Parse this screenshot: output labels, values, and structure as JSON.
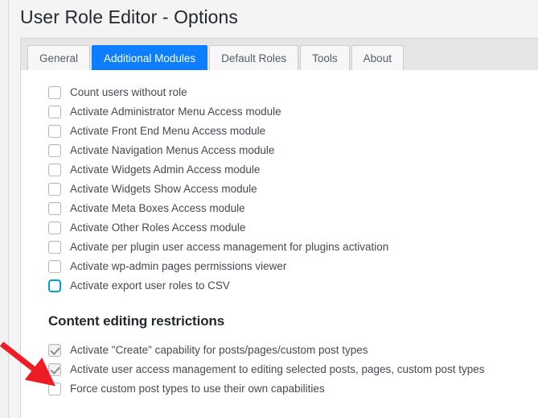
{
  "page": {
    "title": "User Role Editor - Options"
  },
  "tabs": [
    {
      "label": "General",
      "active": false
    },
    {
      "label": "Additional Modules",
      "active": true
    },
    {
      "label": "Default Roles",
      "active": false
    },
    {
      "label": "Tools",
      "active": false
    },
    {
      "label": "About",
      "active": false
    }
  ],
  "modules": {
    "options": [
      {
        "label": "Count users without role",
        "checked": false,
        "focused": false
      },
      {
        "label": "Activate Administrator Menu Access module",
        "checked": false,
        "focused": false
      },
      {
        "label": "Activate Front End Menu Access module",
        "checked": false,
        "focused": false
      },
      {
        "label": "Activate Navigation Menus Access module",
        "checked": false,
        "focused": false
      },
      {
        "label": "Activate Widgets Admin Access module",
        "checked": false,
        "focused": false
      },
      {
        "label": "Activate Widgets Show Access module",
        "checked": false,
        "focused": false
      },
      {
        "label": "Activate Meta Boxes Access module",
        "checked": false,
        "focused": false
      },
      {
        "label": "Activate Other Roles Access module",
        "checked": false,
        "focused": false
      },
      {
        "label": "Activate per plugin user access management for plugins activation",
        "checked": false,
        "focused": false
      },
      {
        "label": "Activate wp-admin pages permissions viewer",
        "checked": false,
        "focused": false
      },
      {
        "label": "Activate export user roles to CSV",
        "checked": false,
        "focused": true
      }
    ]
  },
  "content_restrictions": {
    "heading": "Content editing restrictions",
    "options": [
      {
        "label": "Activate \"Create\" capability for posts/pages/custom post types",
        "checked": true,
        "focused": false
      },
      {
        "label": "Activate user access management to editing selected posts, pages, custom post types",
        "checked": true,
        "focused": false
      },
      {
        "label": "Force custom post types to use their own capabilities",
        "checked": false,
        "focused": false
      }
    ]
  },
  "annotation": {
    "type": "arrow",
    "color": "#ee1c25",
    "points_to": "Activate user access management to editing selected posts, pages, custom post types"
  },
  "colors": {
    "active_tab": "#0d7eff",
    "focus_outline": "#00a0d2",
    "title_text": "#23282d",
    "label_text": "#444a50",
    "tab_strip_bg": "#e5e5e5",
    "panel_bg": "#ffffff",
    "page_bg": "#f1f1f1",
    "annotation": "#ee1c25"
  }
}
